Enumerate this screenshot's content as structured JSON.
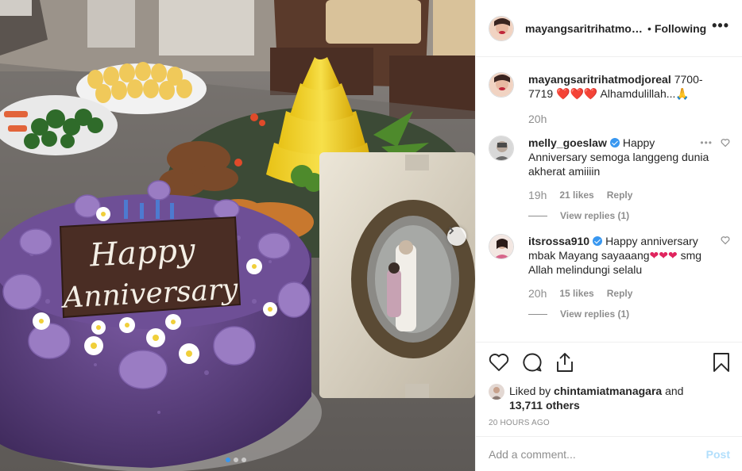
{
  "post": {
    "author": "mayangsaritrihatmodjoreal",
    "header_separator": "•",
    "follow_status": "Following",
    "more_label": "•••",
    "image_text": {
      "line1": "Happy",
      "line2": "Anniversary"
    },
    "carousel": {
      "slides": 3,
      "current": 1
    }
  },
  "caption": {
    "user": "mayangsaritrihatmodjoreal",
    "text": "7700-7719",
    "emojis": "❤️❤️❤️",
    "text2": "Alhamdulillah...",
    "emoji2": "🙏",
    "time": "20h"
  },
  "comments": [
    {
      "user": "melly_goeslaw",
      "verified": true,
      "text": "Happy Anniversary semoga langgeng dunia akherat amiiiin",
      "time": "19h",
      "likes": "21 likes",
      "reply": "Reply",
      "view_replies": "View replies (1)",
      "more": "•••"
    },
    {
      "user": "itsrossa910",
      "verified": true,
      "text": "Happy anniversary mbak Mayang sayaaang",
      "hearts": "❤❤❤",
      "text2": "smg Allah melindungi selalu",
      "time": "20h",
      "likes": "15 likes",
      "reply": "Reply",
      "view_replies": "View replies (1)"
    }
  ],
  "actions": {
    "liked_by_prefix": "Liked by",
    "liked_by_user": "chintamiatmanagara",
    "liked_by_and": "and",
    "others_count": "13,711 others",
    "timestamp": "20 HOURS AGO"
  },
  "add_comment": {
    "placeholder": "Add a comment...",
    "post_label": "Post"
  },
  "colors": {
    "link_blue": "#3897f0",
    "post_disabled": "#b2dffc",
    "muted_text": "#8e8e8e",
    "cake_purple": "#5b3e7d",
    "heart_red": "#e0245e"
  }
}
